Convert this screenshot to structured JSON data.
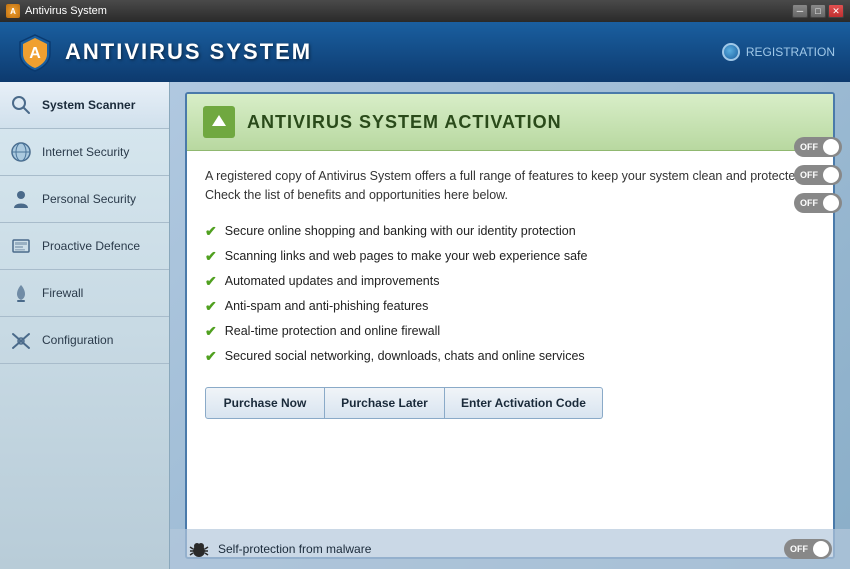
{
  "window": {
    "title": "Antivirus System",
    "controls": [
      "minimize",
      "maximize",
      "close"
    ]
  },
  "header": {
    "title": "ANTIVIRUS SYSTEM",
    "registration_label": "REGISTRATION"
  },
  "sidebar": {
    "items": [
      {
        "id": "system-scanner",
        "label": "System Scanner",
        "active": true
      },
      {
        "id": "internet-security",
        "label": "Internet Security",
        "active": false
      },
      {
        "id": "personal-security",
        "label": "Personal Security",
        "active": false
      },
      {
        "id": "proactive-defence",
        "label": "Proactive Defence",
        "active": false
      },
      {
        "id": "firewall",
        "label": "Firewall",
        "active": false
      },
      {
        "id": "configuration",
        "label": "Configuration",
        "active": false
      }
    ]
  },
  "activation": {
    "title": "ANTIVIRUS SYSTEM ACTIVATION",
    "description": "A registered copy of Antivirus System offers a full range of features to keep your system clean and protected. Check the list of benefits and opportunities here below.",
    "features": [
      "Secure online shopping and banking with our identity protection",
      "Scanning links and web pages to make your web experience safe",
      "Automated updates and improvements",
      "Anti-spam and anti-phishing features",
      "Real-time protection and online firewall",
      "Secured social networking, downloads, chats and online services"
    ],
    "buttons": {
      "purchase_now": "Purchase Now",
      "purchase_later": "Purchase Later",
      "enter_code": "Enter Activation Code"
    }
  },
  "bottom": {
    "self_protection_label": "Self-protection from malware",
    "toggle_label": "OFF"
  },
  "toggles": {
    "labels": [
      "OFF",
      "OFF",
      "OFF"
    ]
  }
}
